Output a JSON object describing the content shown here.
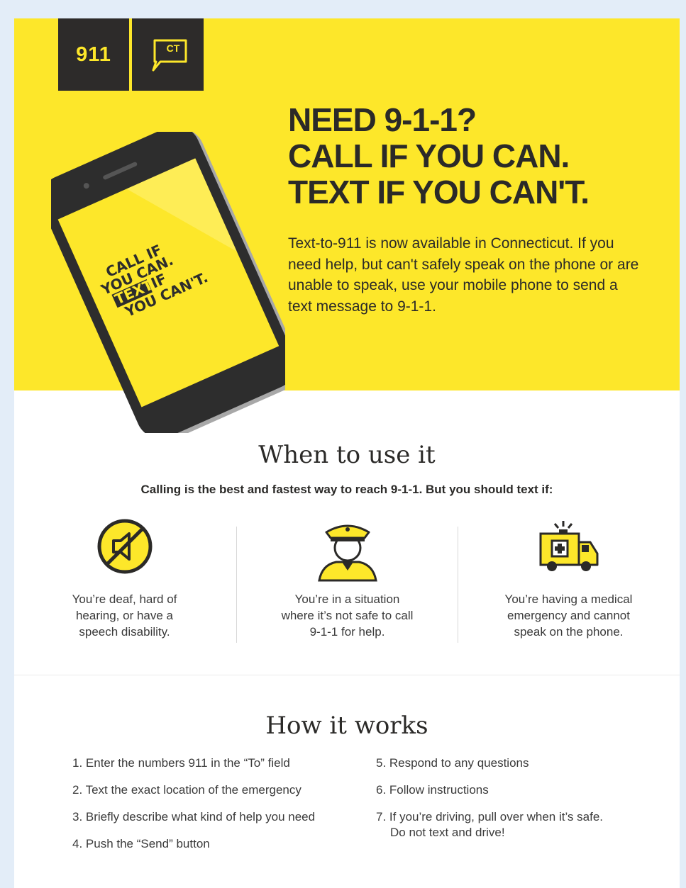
{
  "logo": {
    "number": "911",
    "state": "CT"
  },
  "hero": {
    "headline": [
      "NEED 9-1-1?",
      "CALL IF YOU CAN.",
      "TEXT IF YOU CAN'T."
    ],
    "intro": "Text-to-911 is now available in Connecticut. If you need help, but can't safely speak on the phone or are unable to speak, use your mobile phone to send a text message to 9-1-1.",
    "phone_screen": {
      "line1": "CALL IF",
      "line2": "YOU CAN.",
      "line3_highlight": "TEXT",
      "line3_rest": "IF",
      "line4": "YOU CAN'T."
    }
  },
  "when": {
    "title": "When to use it",
    "subtitle": "Calling is the best and fastest way to reach 9-1-1. But you should text if:",
    "items": [
      {
        "icon": "muted-speaker-icon",
        "lines": [
          "You’re deaf, hard of",
          "hearing, or have a",
          "speech disability."
        ]
      },
      {
        "icon": "police-officer-icon",
        "lines": [
          "You’re in a situation",
          "where it’s not safe to call",
          "9-1-1 for help."
        ]
      },
      {
        "icon": "ambulance-icon",
        "lines": [
          "You’re having a medical",
          "emergency and cannot",
          "speak on the phone."
        ]
      }
    ]
  },
  "how": {
    "title": "How it works",
    "steps_left": [
      "1. Enter the numbers 911 in the “To” field",
      "2. Text the exact location of the emergency",
      "3. Briefly describe what kind of help you need",
      "4. Push the “Send” button"
    ],
    "steps_right": [
      "5. Respond to any questions",
      "6. Follow instructions"
    ],
    "step7": [
      "7. If you’re driving, pull over when it’s safe.",
      "Do not text and drive!"
    ]
  },
  "colors": {
    "yellow": "#fde72a",
    "dark": "#2b2a28"
  }
}
